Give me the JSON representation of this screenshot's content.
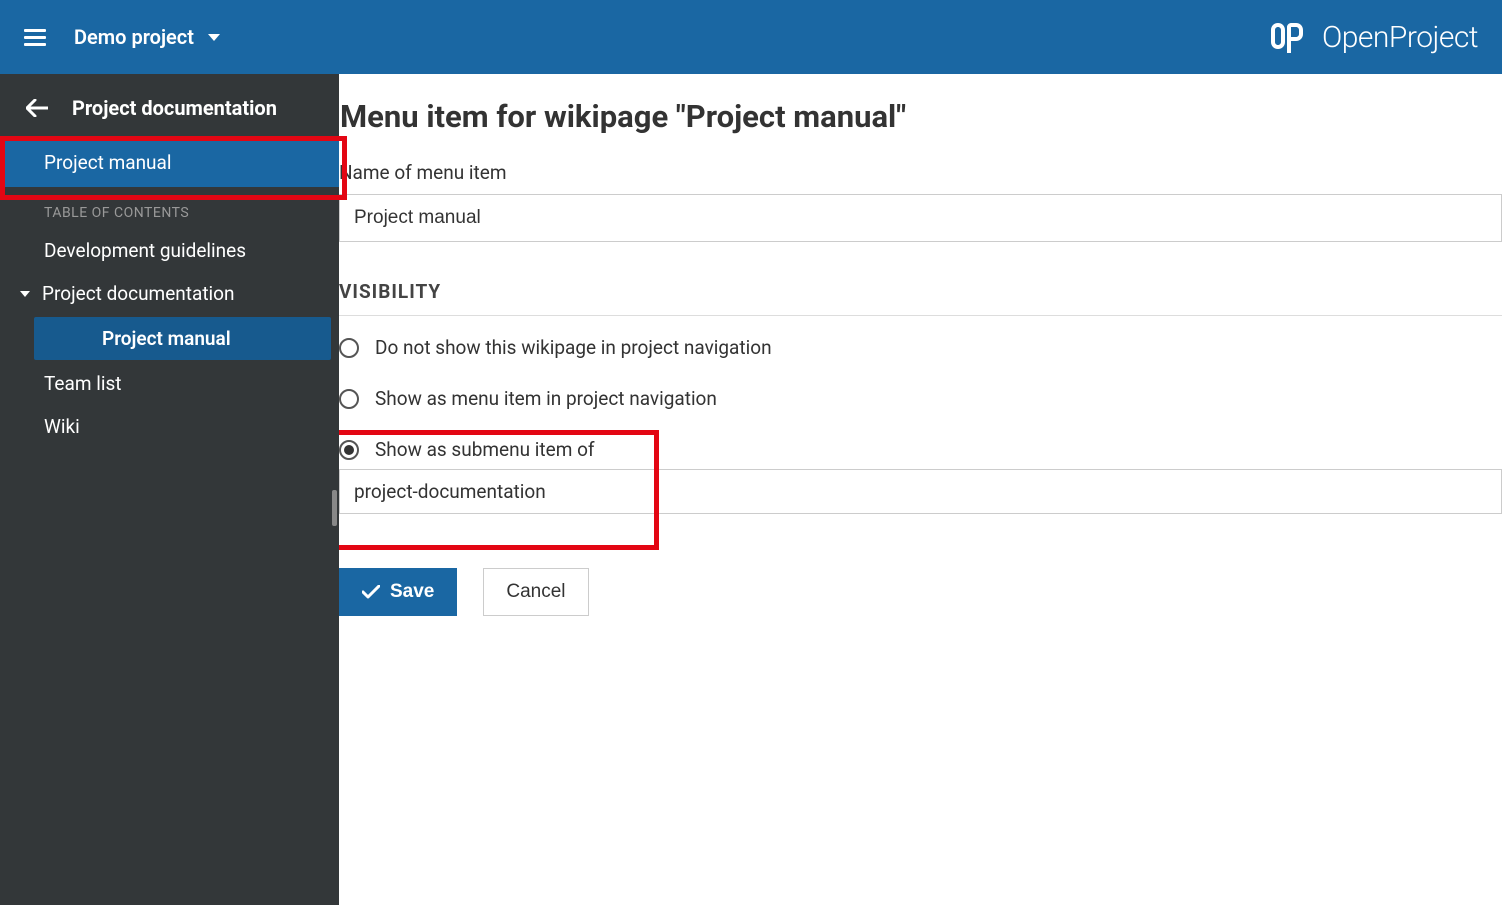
{
  "header": {
    "project_name": "Demo project",
    "product_name": "OpenProject"
  },
  "sidebar": {
    "back_title": "Project documentation",
    "highlight_item": "Project manual",
    "toc_label": "TABLE OF CONTENTS",
    "items": [
      {
        "label": "Development guidelines",
        "type": "item"
      },
      {
        "label": "Project documentation",
        "type": "expandable"
      },
      {
        "label": "Project manual",
        "type": "subitem",
        "active": true
      },
      {
        "label": "Team list",
        "type": "item"
      },
      {
        "label": "Wiki",
        "type": "item"
      }
    ]
  },
  "main": {
    "page_title": "Menu item for wikipage \"Project manual\"",
    "name_label": "Name of menu item",
    "name_value": "Project manual",
    "visibility_header": "VISIBILITY",
    "options": [
      {
        "label": "Do not show this wikipage in project navigation",
        "checked": false
      },
      {
        "label": "Show as menu item in project navigation",
        "checked": false
      },
      {
        "label": "Show as submenu item of",
        "checked": true
      }
    ],
    "submenu_parent": "project-documentation",
    "save_label": "Save",
    "cancel_label": "Cancel"
  }
}
